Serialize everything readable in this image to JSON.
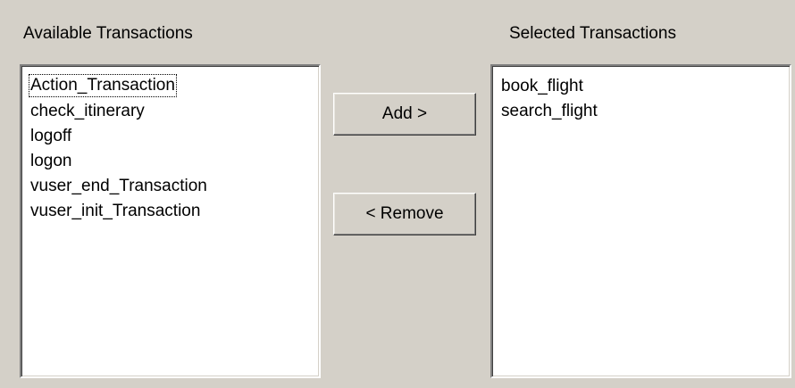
{
  "available": {
    "label": "Available Transactions",
    "items": [
      "Action_Transaction",
      "check_itinerary",
      "logoff",
      "logon",
      "vuser_end_Transaction",
      "vuser_init_Transaction"
    ]
  },
  "selected": {
    "label": "Selected Transactions",
    "items": [
      "book_flight",
      "search_flight"
    ]
  },
  "buttons": {
    "add_label": "Add >",
    "remove_label": "< Remove"
  }
}
